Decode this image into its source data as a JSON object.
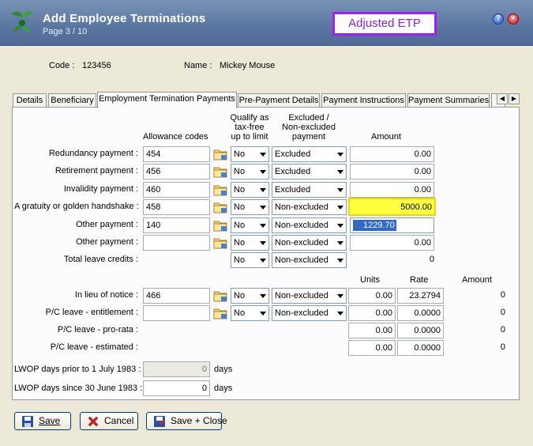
{
  "window": {
    "title": "Add Employee Terminations",
    "subtitle": "Page 3 / 10",
    "annotation": "Adjusted ETP",
    "help": "?",
    "close": "×"
  },
  "employee": {
    "code_label": "Code :",
    "code": "123456",
    "name_label": "Name :",
    "name": "Mickey Mouse"
  },
  "tabs": [
    "Details",
    "Beneficiary",
    "Employment Termination Payments",
    "Pre-Payment Details",
    "Payment Instructions",
    "Payment Summaries"
  ],
  "headers": {
    "allowance_codes": "Allowance codes",
    "qualify_line1": "Qualify as",
    "qualify_line2": "tax-free",
    "qualify_line3": "up to limit",
    "excluded_line1": "Excluded /",
    "excluded_line2": "Non-excluded",
    "excluded_line3": "payment",
    "amount": "Amount",
    "units": "Units",
    "rate": "Rate",
    "amount2": "Amount"
  },
  "rows": [
    {
      "label": "Redundancy payment :",
      "code": "454",
      "qualify": "No",
      "excluded": "Excluded",
      "amount": "0.00"
    },
    {
      "label": "Retirement payment :",
      "code": "456",
      "qualify": "No",
      "excluded": "Excluded",
      "amount": "0.00"
    },
    {
      "label": "Invalidity payment :",
      "code": "460",
      "qualify": "No",
      "excluded": "Excluded",
      "amount": "0.00"
    },
    {
      "label": "A gratuity or golden handshake :",
      "code": "458",
      "qualify": "No",
      "excluded": "Non-excluded",
      "amount": "5000.00"
    },
    {
      "label": "Other payment :",
      "code": "140",
      "qualify": "No",
      "excluded": "Non-excluded",
      "amount": "1229.70"
    },
    {
      "label": "Other payment :",
      "code": "",
      "qualify": "No",
      "excluded": "Non-excluded",
      "amount": "0.00"
    }
  ],
  "total_leave": {
    "label": "Total leave credits :",
    "qualify": "No",
    "excluded": "Non-excluded",
    "amount": "0"
  },
  "rate_rows": [
    {
      "label": "In lieu of notice :",
      "code": "466",
      "qualify": "No",
      "excluded": "Non-excluded",
      "units": "0.00",
      "rate": "23.2794",
      "amount": "0"
    },
    {
      "label": "P/C leave - entitlement :",
      "code": "",
      "qualify": "No",
      "excluded": "Non-excluded",
      "units": "0.00",
      "rate": "0.0000",
      "amount": "0"
    },
    {
      "label": "P/C leave - pro-rata :",
      "units": "0.00",
      "rate": "0.0000",
      "amount": "0"
    },
    {
      "label": "P/C leave - estimated :",
      "units": "0.00",
      "rate": "0.0000",
      "amount": "0"
    }
  ],
  "lwop": [
    {
      "label": "LWOP days prior to 1 July 1983 :",
      "value": "0",
      "unit": "days"
    },
    {
      "label": "LWOP days since 30 June 1983 :",
      "value": "0",
      "unit": "days"
    }
  ],
  "buttons": {
    "save": "Save",
    "cancel": "Cancel",
    "save_close": "Save + Close"
  },
  "colors": {
    "highlight_yellow": "#ffff40",
    "selection_blue": "#316ac5",
    "annotation_purple": "#a020f0"
  }
}
